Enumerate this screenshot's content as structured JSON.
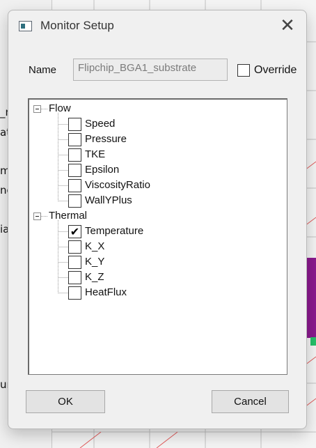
{
  "background": {
    "left_fragments": [
      "_n",
      "at",
      "ma",
      "nd",
      "ial",
      "ur"
    ]
  },
  "dialog": {
    "title": "Monitor Setup",
    "close_glyph": "✕",
    "name_label": "Name",
    "name_value": "Flipchip_BGA1_substrate",
    "override_label": "Override",
    "override_checked": false,
    "tree": [
      {
        "label": "Flow",
        "expanded": true,
        "children": [
          {
            "label": "Speed",
            "checked": false
          },
          {
            "label": "Pressure",
            "checked": false
          },
          {
            "label": "TKE",
            "checked": false
          },
          {
            "label": "Epsilon",
            "checked": false
          },
          {
            "label": "ViscosityRatio",
            "checked": false
          },
          {
            "label": "WallYPlus",
            "checked": false
          }
        ]
      },
      {
        "label": "Thermal",
        "expanded": true,
        "children": [
          {
            "label": "Temperature",
            "checked": true
          },
          {
            "label": "K_X",
            "checked": false
          },
          {
            "label": "K_Y",
            "checked": false
          },
          {
            "label": "K_Z",
            "checked": false
          },
          {
            "label": "HeatFlux",
            "checked": false
          }
        ]
      }
    ],
    "check_glyph": "✔",
    "ok_label": "OK",
    "cancel_label": "Cancel"
  },
  "colors": {
    "accent_magenta": "#8a1a8e",
    "grid_red": "#e25b5b",
    "accent_green": "#27c06a"
  }
}
